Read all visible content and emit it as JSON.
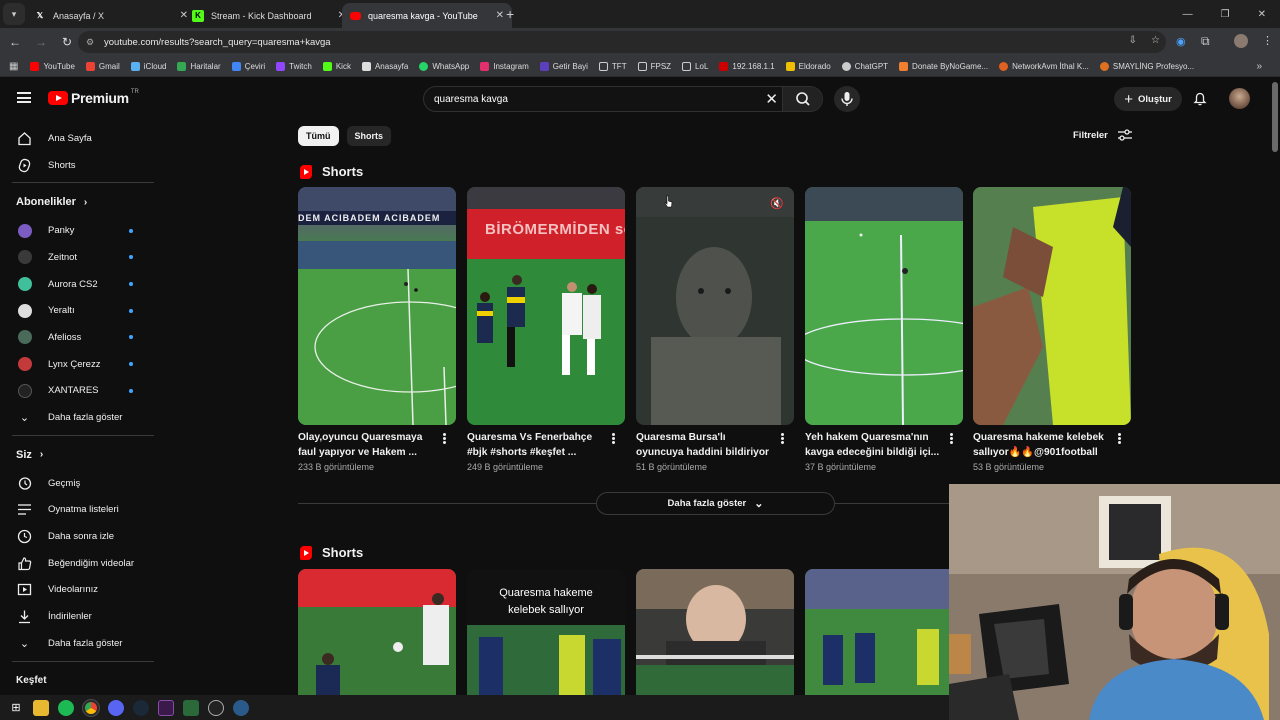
{
  "browser": {
    "tabs": [
      {
        "title": "Anasayfa / X",
        "icon": "x-icon"
      },
      {
        "title": "Stream - Kick Dashboard",
        "icon": "kick-icon"
      },
      {
        "title": "quaresma kavga - YouTube",
        "icon": "youtube-icon",
        "active": true
      }
    ],
    "url": "youtube.com/results?search_query=quaresma+kavga",
    "bookmarks": [
      "YouTube",
      "Gmail",
      "iCloud",
      "Haritalar",
      "Çeviri",
      "Twitch",
      "Kick",
      "Anasayfa",
      "WhatsApp",
      "Instagram",
      "Getir Bayi",
      "TFT",
      "FPSZ",
      "LoL",
      "192.168.1.1",
      "Eldorado",
      "ChatGPT",
      "Donate ByNoGame...",
      "NetworkAvm İthal K...",
      "SMAYLİNG Profesyo..."
    ]
  },
  "header": {
    "logo_text": "Premium",
    "logo_badge": "TR",
    "search_value": "quaresma kavga",
    "create_label": "Oluştur"
  },
  "sidebar": {
    "main": [
      {
        "label": "Ana Sayfa",
        "icon": "home-icon"
      },
      {
        "label": "Shorts",
        "icon": "shorts-icon"
      }
    ],
    "subs_title": "Abonelikler",
    "subs": [
      {
        "label": "Panky",
        "color": "#7a5cc2"
      },
      {
        "label": "Zeitnot",
        "color": "#3a3a3a"
      },
      {
        "label": "Aurora CS2",
        "color": "#3fbf9a"
      },
      {
        "label": "Yeraltı",
        "color": "#dddddd"
      },
      {
        "label": "Afelioss",
        "color": "#4a6a5a"
      },
      {
        "label": "Lynx Çerezz",
        "color": "#c23a3a"
      },
      {
        "label": "XANTARES",
        "color": "#222222"
      }
    ],
    "subs_more": "Daha fazla göster",
    "you_title": "Siz",
    "you": [
      {
        "label": "Geçmiş",
        "icon": "history-icon"
      },
      {
        "label": "Oynatma listeleri",
        "icon": "playlist-icon"
      },
      {
        "label": "Daha sonra izle",
        "icon": "clock-icon"
      },
      {
        "label": "Beğendiğim videolar",
        "icon": "like-icon"
      },
      {
        "label": "Videolarınız",
        "icon": "video-icon"
      },
      {
        "label": "İndirilenler",
        "icon": "download-icon"
      },
      {
        "label": "Daha fazla göster",
        "icon": "chevron-down-icon"
      }
    ],
    "explore_title": "Keşfet"
  },
  "filters": {
    "chips": [
      "Tümü",
      "Shorts"
    ],
    "active_chip": "Tümü",
    "filter_label": "Filtreler"
  },
  "section1": {
    "title": "Shorts",
    "cards": [
      {
        "title": "Olay,oyuncu Quaresmaya faul yapıyor ve Hakem ...",
        "views": "233 B görüntüleme"
      },
      {
        "title": "Quaresma Vs Fenerbahçe #bjk #shorts #keşfet ...",
        "views": "249 B görüntüleme"
      },
      {
        "title": "Quaresma Bursa'lı oyuncuya haddini bildiriyor",
        "views": "51 B görüntüleme"
      },
      {
        "title": "Yeh hakem Quaresma'nın kavga edeceğini bildiği içi...",
        "views": "37 B görüntüleme"
      },
      {
        "title": "Quaresma hakeme kelebek sallıyor🔥🔥@901football",
        "views": "53 B görüntüleme"
      }
    ],
    "show_more": "Daha fazla göster"
  },
  "section2": {
    "title": "Shorts",
    "thumb_texts": [
      "Quaresma hakeme kelebek sallıyor"
    ]
  },
  "thumb_labels": {
    "acibadem": "DEM ACIBADEM ACIBADEM",
    "bjk_text": "BİRÖMERMİDEN se"
  }
}
